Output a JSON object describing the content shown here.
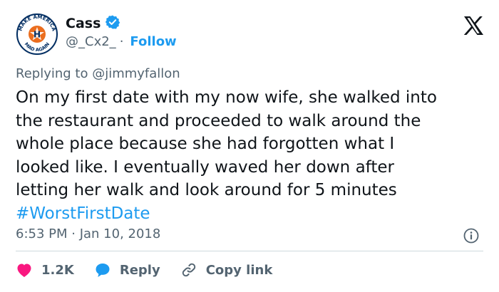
{
  "author": {
    "display_name": "Cass",
    "handle": "@_Cx2_",
    "follow_label": "Follow",
    "verified": true,
    "avatar_text_top": "MAKE AMERICA",
    "avatar_text_bottom": "MAD AGAIN",
    "avatar_letter": "H"
  },
  "reply_context": {
    "prefix": "Replying to ",
    "mention": "@jimmyfallon"
  },
  "tweet": {
    "text": "On my first date with my now wife, she walked into\nthe restaurant and proceeded to walk around the\nwhole place because she had forgotten what I\nlooked like. I eventually waved her down after\nletting her walk and look around for 5 minutes",
    "hashtag": "#WorstFirstDate",
    "timestamp": "6:53 PM · Jan 10, 2018"
  },
  "actions": {
    "like_count": "1.2K",
    "reply_label": "Reply",
    "copy_link_label": "Copy link"
  },
  "colors": {
    "accent": "#1d9bf0",
    "like": "#f91880",
    "secondary_text": "#536471"
  },
  "icons": {
    "verified": "verified-badge-icon",
    "platform": "x-logo-icon",
    "info": "info-icon",
    "like": "heart-icon",
    "reply": "speech-bubble-icon",
    "copy": "link-icon"
  }
}
